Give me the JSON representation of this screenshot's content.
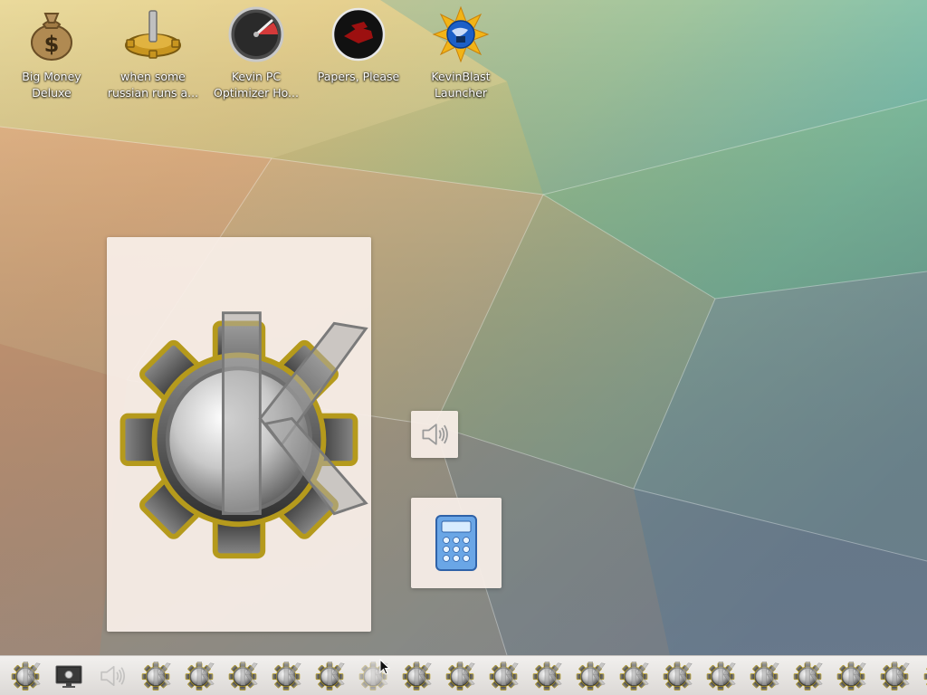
{
  "desktop": {
    "icons": [
      {
        "name": "money-bag-icon",
        "label": "Big Money Deluxe"
      },
      {
        "name": "gear-lever-icon",
        "label": "when some russian runs a..."
      },
      {
        "name": "speedometer-icon",
        "label": "Kevin PC Optimizer Ho..."
      },
      {
        "name": "papers-please-icon",
        "label": "Papers, Please"
      },
      {
        "name": "globe-star-icon",
        "label": "KevinBlast Launcher"
      }
    ]
  },
  "taskbar": {
    "items": [
      {
        "icon": "kde-gear-icon"
      },
      {
        "icon": "monitor-icon"
      },
      {
        "icon": "speaker-icon",
        "faded": true
      },
      {
        "icon": "kde-gear-icon"
      },
      {
        "icon": "kde-gear-icon"
      },
      {
        "icon": "kde-gear-icon"
      },
      {
        "icon": "kde-gear-icon"
      },
      {
        "icon": "kde-gear-icon"
      },
      {
        "icon": "kde-gear-icon",
        "faded": true
      },
      {
        "icon": "kde-gear-icon"
      },
      {
        "icon": "kde-gear-icon"
      },
      {
        "icon": "kde-gear-icon"
      },
      {
        "icon": "kde-gear-icon"
      },
      {
        "icon": "kde-gear-icon"
      },
      {
        "icon": "kde-gear-icon"
      },
      {
        "icon": "kde-gear-icon"
      },
      {
        "icon": "kde-gear-icon"
      },
      {
        "icon": "kde-gear-icon"
      },
      {
        "icon": "kde-gear-icon"
      },
      {
        "icon": "kde-gear-icon"
      },
      {
        "icon": "kde-gear-icon"
      },
      {
        "icon": "kde-gear-icon"
      }
    ]
  }
}
